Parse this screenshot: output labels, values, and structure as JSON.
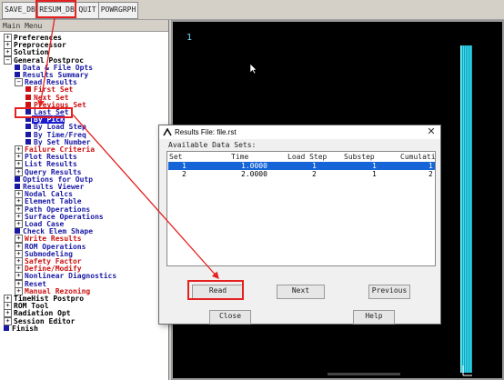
{
  "toolbar": {
    "buttons": [
      "SAVE_DB",
      "RESUM_DB",
      "QUIT",
      "POWRGRPH"
    ]
  },
  "menu": {
    "title": "Main Menu",
    "items": [
      {
        "toggle": "⊞",
        "label": "Preferences"
      },
      {
        "toggle": "⊞",
        "label": "Preprocessor"
      },
      {
        "toggle": "⊞",
        "label": "Solution"
      },
      {
        "toggle": "⊟",
        "label": "General Postproc"
      },
      {
        "toggle": "",
        "label": "Data & File Opts"
      },
      {
        "toggle": "",
        "label": "Results Summary"
      },
      {
        "toggle": "⊟",
        "label": "Read Results"
      },
      {
        "toggle": "",
        "label": "First Set"
      },
      {
        "toggle": "",
        "label": "Next Set"
      },
      {
        "toggle": "",
        "label": "Previous Set"
      },
      {
        "toggle": "",
        "label": "Last Set"
      },
      {
        "toggle": "",
        "label": "By Pick"
      },
      {
        "toggle": "",
        "label": "By Load Step"
      },
      {
        "toggle": "",
        "label": "By Time/Freq"
      },
      {
        "toggle": "",
        "label": "By Set Number"
      },
      {
        "toggle": "⊞",
        "label": "Failure Criteria"
      },
      {
        "toggle": "⊞",
        "label": "Plot Results"
      },
      {
        "toggle": "⊞",
        "label": "List Results"
      },
      {
        "toggle": "⊞",
        "label": "Query Results"
      },
      {
        "toggle": "",
        "label": "Options for Outp"
      },
      {
        "toggle": "",
        "label": "Results Viewer"
      },
      {
        "toggle": "⊞",
        "label": "Nodal Calcs"
      },
      {
        "toggle": "⊞",
        "label": "Element Table"
      },
      {
        "toggle": "⊞",
        "label": "Path Operations"
      },
      {
        "toggle": "⊞",
        "label": "Surface Operations"
      },
      {
        "toggle": "⊞",
        "label": "Load Case"
      },
      {
        "toggle": "",
        "label": "Check Elem Shape"
      },
      {
        "toggle": "⊞",
        "label": "Write Results"
      },
      {
        "toggle": "⊞",
        "label": "ROM Operations"
      },
      {
        "toggle": "⊞",
        "label": "Submodeling"
      },
      {
        "toggle": "⊞",
        "label": "Safety Factor"
      },
      {
        "toggle": "⊞",
        "label": "Define/Modify"
      },
      {
        "toggle": "⊞",
        "label": "Nonlinear Diagnostics"
      },
      {
        "toggle": "⊞",
        "label": "Reset"
      },
      {
        "toggle": "⊞",
        "label": "Manual Rezoning"
      },
      {
        "toggle": "⊞",
        "label": "TimeHist Postpro"
      },
      {
        "toggle": "⊞",
        "label": "ROM Tool"
      },
      {
        "toggle": "⊞",
        "label": "Radiation Opt"
      },
      {
        "toggle": "⊞",
        "label": "Session Editor"
      },
      {
        "toggle": "",
        "label": "Finish"
      }
    ]
  },
  "graphics": {
    "window_number": "1"
  },
  "dialog": {
    "title": "Results File: file.rst",
    "available_label": "Available Data Sets:",
    "columns": [
      "Set",
      "Time",
      "Load Step",
      "Substep",
      "Cumulati"
    ],
    "rows": [
      {
        "set": "1",
        "time": "1.0000",
        "load_step": "1",
        "substep": "1",
        "cumulative": "1"
      },
      {
        "set": "2",
        "time": "2.0000",
        "load_step": "2",
        "substep": "1",
        "cumulative": "2"
      }
    ],
    "buttons": {
      "read": "Read",
      "next": "Next",
      "previous": "Previous",
      "close": "Close",
      "help": "Help"
    }
  },
  "colors": {
    "annotation": "#e52020",
    "selection": "#1565d8"
  }
}
